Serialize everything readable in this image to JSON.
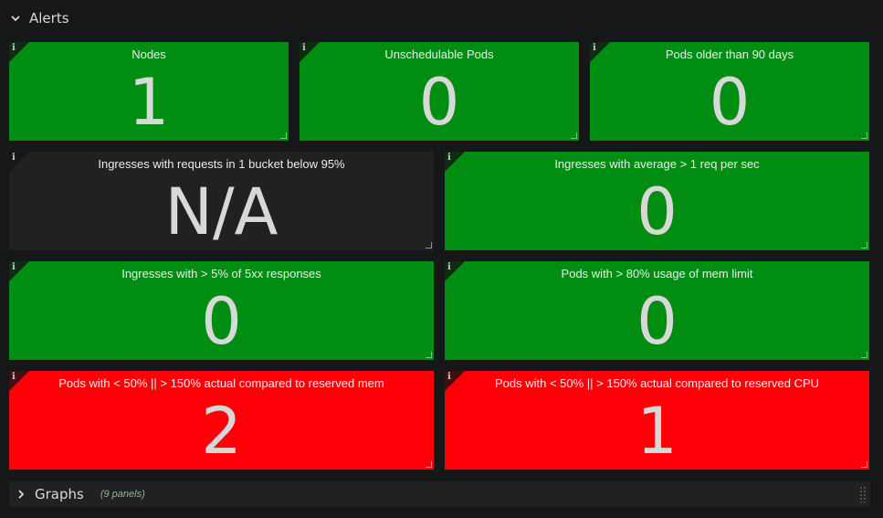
{
  "alerts_row": {
    "title": "Alerts"
  },
  "panels": [
    {
      "title": "Nodes",
      "value": "1",
      "status": "green"
    },
    {
      "title": "Unschedulable Pods",
      "value": "0",
      "status": "green"
    },
    {
      "title": "Pods older than 90 days",
      "value": "0",
      "status": "green"
    },
    {
      "title": "Ingresses with requests in 1 bucket below 95%",
      "value": "N/A",
      "status": "none"
    },
    {
      "title": "Ingresses with average > 1 req per sec",
      "value": "0",
      "status": "green"
    },
    {
      "title": "Ingresses with > 5% of 5xx responses",
      "value": "0",
      "status": "green"
    },
    {
      "title": "Pods with > 80% usage of mem limit",
      "value": "0",
      "status": "green"
    },
    {
      "title": "Pods with < 50% || > 150% actual compared to reserved mem",
      "value": "2",
      "status": "red"
    },
    {
      "title": "Pods with < 50% || > 150% actual compared to reserved CPU",
      "value": "1",
      "status": "red"
    }
  ],
  "graphs_row": {
    "title": "Graphs",
    "count": "(9 panels)"
  },
  "colors": {
    "green": "#008d12",
    "red": "#ff0008",
    "none": "#212124",
    "background": "#161719"
  },
  "icons": {
    "info": "info-icon",
    "collapse": "chevron-down-icon",
    "expand": "chevron-right-icon"
  }
}
